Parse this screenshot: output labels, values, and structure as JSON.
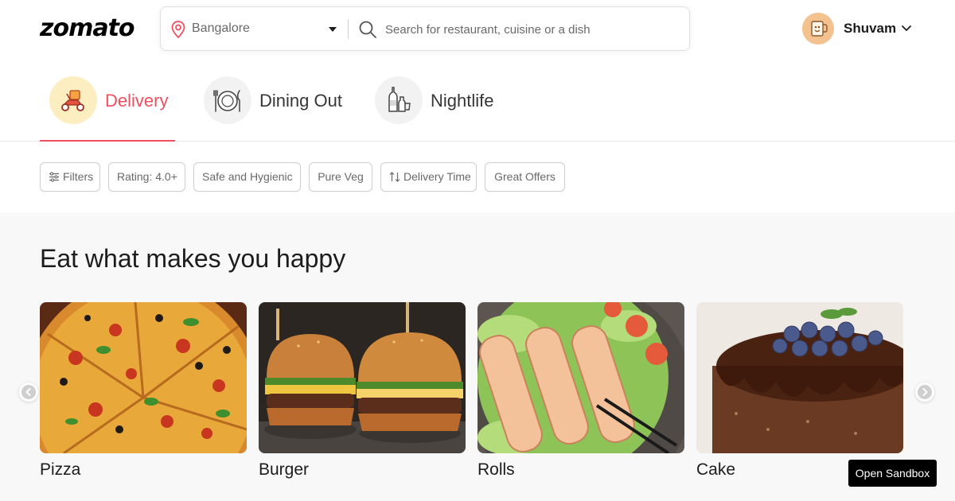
{
  "header": {
    "logo": "zomato",
    "location": "Bangalore",
    "search_placeholder": "Search for restaurant, cuisine or a dish",
    "user_name": "Shuvam"
  },
  "tabs": [
    {
      "label": "Delivery",
      "icon": "scooter-icon",
      "active": true
    },
    {
      "label": "Dining Out",
      "icon": "plate-icon",
      "active": false
    },
    {
      "label": "Nightlife",
      "icon": "bottles-icon",
      "active": false
    }
  ],
  "filters": [
    {
      "label": "Filters",
      "icon": "sliders-icon"
    },
    {
      "label": "Rating: 4.0+"
    },
    {
      "label": "Safe and Hygienic"
    },
    {
      "label": "Pure Veg"
    },
    {
      "label": "Delivery Time",
      "icon": "sort-icon"
    },
    {
      "label": "Great Offers"
    }
  ],
  "section": {
    "title": "Eat what makes you happy",
    "items": [
      {
        "label": "Pizza"
      },
      {
        "label": "Burger"
      },
      {
        "label": "Rolls"
      },
      {
        "label": "Cake"
      }
    ]
  },
  "sandbox_label": "Open Sandbox",
  "colors": {
    "accent": "#ef4f5f",
    "text": "#1c1c1c",
    "muted": "#696969",
    "section_bg": "#f8f8f8"
  }
}
